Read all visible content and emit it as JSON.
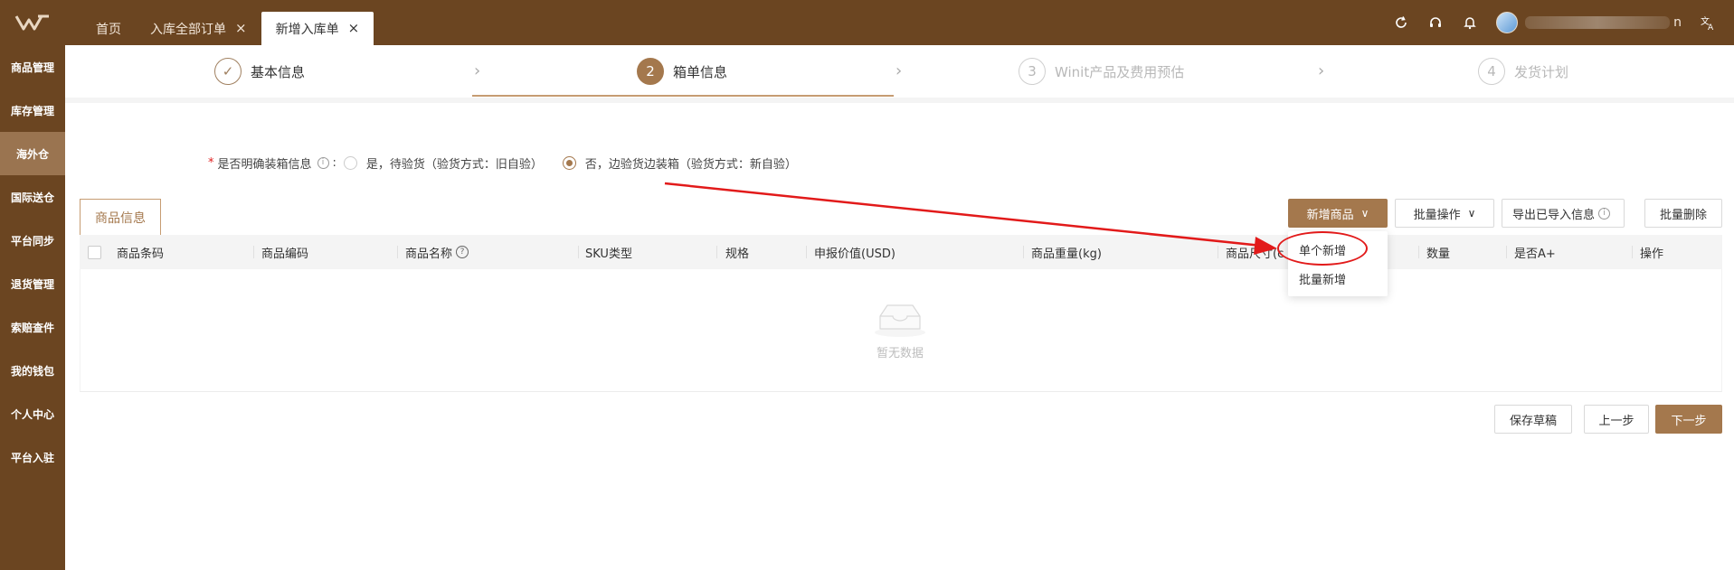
{
  "topbar": {
    "logo_icon": "brand-logo-icon",
    "tabs": [
      {
        "label": "首页",
        "closable": false
      },
      {
        "label": "入库全部订单",
        "closable": true
      },
      {
        "label": "新增入库单",
        "closable": true,
        "active": true
      }
    ],
    "close_glyph": "×",
    "user_suffix": "n",
    "icons": [
      "refresh-icon",
      "headset-icon",
      "bell-icon",
      "avatar",
      "translate-icon"
    ]
  },
  "sidebar": {
    "items": [
      {
        "label": "商品管理"
      },
      {
        "label": "库存管理"
      },
      {
        "label": "海外仓",
        "active": true
      },
      {
        "label": "国际送仓"
      },
      {
        "label": "平台同步"
      },
      {
        "label": "退货管理"
      },
      {
        "label": "索赔查件"
      },
      {
        "label": "我的钱包"
      },
      {
        "label": "个人中心"
      },
      {
        "label": "平台入驻"
      }
    ]
  },
  "steps": [
    {
      "number": "✓",
      "label": "基本信息",
      "state": "done"
    },
    {
      "number": "2",
      "label": "箱单信息",
      "state": "active"
    },
    {
      "number": "3",
      "label": "Winit产品及费用预估",
      "state": "pending"
    },
    {
      "number": "4",
      "label": "发货计划",
      "state": "pending"
    }
  ],
  "packing": {
    "required_mark": "*",
    "question": "是否明确装箱信息",
    "info_glyph": "i",
    "colon": ":",
    "option_yes": "是，待验货（验货方式：旧自验）",
    "option_no": "否，边验货边装箱（验货方式：新自验）",
    "selected": "no"
  },
  "card_tab": "商品信息",
  "actions": {
    "add_product": "新增商品",
    "batch_ops": "批量操作",
    "export_imported": "导出已导入信息",
    "batch_delete": "批量删除",
    "chevron": "∨",
    "info_glyph": "i"
  },
  "dropdown": {
    "items": [
      "单个新增",
      "批量新增"
    ]
  },
  "table": {
    "columns": [
      "商品条码",
      "商品编码",
      "商品名称",
      "SKU类型",
      "规格",
      "申报价值(USD)",
      "商品重量(kg)",
      "商品尺寸(c",
      "数量",
      "是否A+",
      "操作"
    ],
    "help_glyph": "?",
    "empty_text": "暂无数据"
  },
  "footer": {
    "save_draft": "保存草稿",
    "prev": "上一步",
    "next": "下一步"
  },
  "colors": {
    "brand": "#6b4521",
    "accent": "#a4784d",
    "annotation": "#e21a1a"
  }
}
